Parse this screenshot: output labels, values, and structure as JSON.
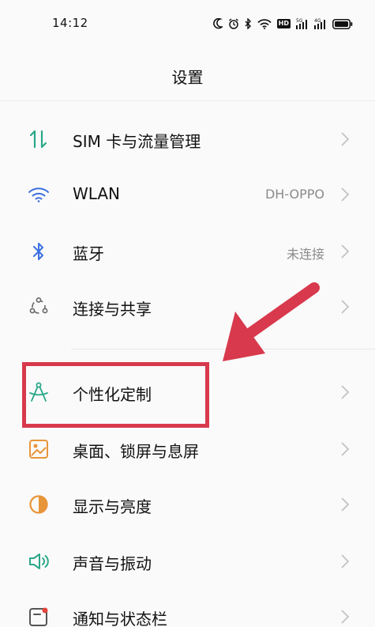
{
  "status_bar": {
    "time": "14:12",
    "icons": [
      "moon-icon",
      "alarm-icon",
      "bluetooth-icon",
      "wifi-icon",
      "hd-icon",
      "signal-5g-icon",
      "signal-4g-icon",
      "battery-icon"
    ],
    "hd_label": "HD",
    "network_5g": "5G",
    "network_4g": "4G"
  },
  "header": {
    "title": "设置"
  },
  "settings": {
    "items": [
      {
        "label": "SIM 卡与流量管理",
        "value": "",
        "icon": "sim-data-icon"
      },
      {
        "label": "WLAN",
        "value": "DH-OPPO",
        "icon": "wifi-icon"
      },
      {
        "label": "蓝牙",
        "value": "未连接",
        "icon": "bluetooth-icon"
      },
      {
        "label": "连接与共享",
        "value": "",
        "icon": "connection-share-icon"
      },
      {
        "label": "个性化定制",
        "value": "",
        "icon": "personalization-icon"
      },
      {
        "label": "桌面、锁屏与息屏",
        "value": "",
        "icon": "wallpaper-icon"
      },
      {
        "label": "显示与亮度",
        "value": "",
        "icon": "brightness-icon"
      },
      {
        "label": "声音与振动",
        "value": "",
        "icon": "sound-icon"
      },
      {
        "label": "通知与状态栏",
        "value": "",
        "icon": "notification-icon"
      }
    ]
  },
  "annotation": {
    "highlighted_item": "个性化定制",
    "color": "#d8394c"
  },
  "colors": {
    "accent_green": "#2aa889",
    "icon_blue": "#3a6fe0",
    "annotation_red": "#d8394c"
  }
}
